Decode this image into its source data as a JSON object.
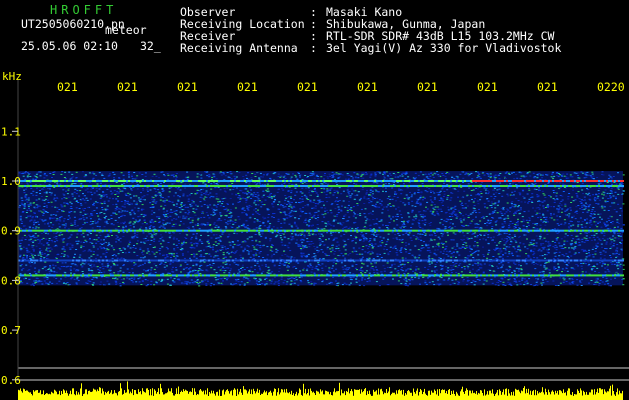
{
  "header": {
    "logo": "HROFFT",
    "filename": "UT2505060210.pn",
    "meteor_label": "meteor",
    "datetime": "25.05.06 02:10",
    "count": "32_",
    "meta": [
      {
        "label": "Observer",
        "value": "Masaki Kano"
      },
      {
        "label": "Receiving Location",
        "value": "Shibukawa, Gunma, Japan"
      },
      {
        "label": "Receiver",
        "value": "RTL-SDR SDR# 43dB L15 103.2MHz CW"
      },
      {
        "label": "Receiving Antenna",
        "value": "3el Yagi(V) Az 330 for Vladivostok"
      }
    ]
  },
  "colors": {
    "background": "#000000",
    "text_white": "#ffffff",
    "text_green": "#33cc33",
    "text_yellow": "#ffff00",
    "trace_yellow": "#ffff00",
    "spectrum_blue": "#0a30d0"
  },
  "chart_data": {
    "type": "heatmap",
    "ylabel": "kHz",
    "ylim": [
      0.6,
      1.2
    ],
    "y_ticks": [
      "1.1",
      "1.0",
      "0.9",
      "0.8",
      "0.7",
      "0.6"
    ],
    "y_tick_values": [
      1.1,
      1.0,
      0.9,
      0.8,
      0.7,
      0.6
    ],
    "x_ticks": [
      "021",
      "021",
      "021",
      "021",
      "021",
      "021",
      "021",
      "021",
      "021",
      "0220"
    ],
    "noise_band": [
      0.79,
      1.02
    ],
    "bright_lines": [
      {
        "freq": 1.0,
        "note": "strong carrier, red-hot on right side"
      },
      {
        "freq": 0.99,
        "note": "secondary carrier"
      },
      {
        "freq": 0.9,
        "note": "green trace"
      },
      {
        "freq": 0.84,
        "note": "faint trace"
      },
      {
        "freq": 0.81,
        "note": "green trace"
      }
    ],
    "bottom_trace": "yellow signal strength bars"
  }
}
